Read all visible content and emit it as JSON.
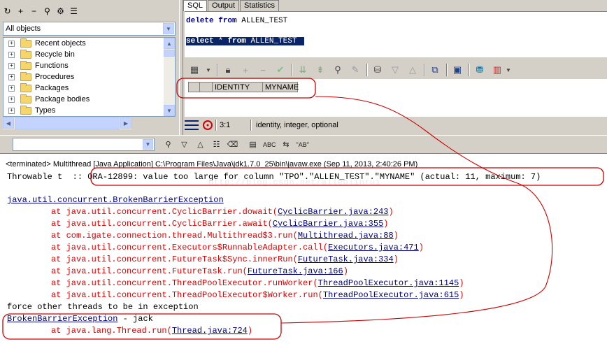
{
  "left_panel": {
    "toolbar_icons": [
      "refresh-icon",
      "add-icon",
      "remove-icon",
      "find-icon",
      "filter-icon",
      "properties-icon"
    ],
    "toolbar_glyphs": [
      "↻",
      "+",
      "−",
      "⚲",
      "⚙",
      "☰"
    ],
    "object_filter": "All objects",
    "tree_items": [
      {
        "label": "Recent objects"
      },
      {
        "label": "Recycle bin"
      },
      {
        "label": "Functions"
      },
      {
        "label": "Procedures"
      },
      {
        "label": "Packages"
      },
      {
        "label": "Package bodies"
      },
      {
        "label": "Types"
      }
    ]
  },
  "sql_pane": {
    "tabs": [
      "SQL",
      "Output",
      "Statistics"
    ],
    "active_tab": "SQL",
    "lines": [
      {
        "kw": [
          "delete",
          "from"
        ],
        "text": "delete from ALLEN_TEST"
      },
      {
        "kw": [
          "select",
          "*",
          "from"
        ],
        "text": "select * from ALLEN_TEST"
      }
    ],
    "line1": {
      "k1": "delete",
      "k2": "from",
      "rest": "ALLEN_TEST"
    },
    "line2": {
      "k1": "select",
      "star": "*",
      "k2": "from",
      "rest": "ALLEN_TEST"
    },
    "grid_columns": [
      "IDENTITY",
      "MYNAME"
    ],
    "status": {
      "position": "3:1",
      "message": "identity, integer, optional"
    }
  },
  "console": {
    "terminated_line": "<terminated> Multithread [Java Application] C:\\Program Files\\Java\\jdk1.7.0_25\\bin\\javaw.exe (Sep 11, 2013, 2:40:26 PM)",
    "throwable_prefix": "Throwable t  :: ",
    "throwable_message": "ORA-12899: value too large for column \"TPO\".\"ALLEN_TEST\".\"MYNAME\" (actual: 11, maximum: 7)",
    "exception_class": "java.util.concurrent.BrokenBarrierException",
    "stack": [
      {
        "method": "at java.util.concurrent.CyclicBarrier.dowait(",
        "src": "CyclicBarrier.java:243"
      },
      {
        "method": "at java.util.concurrent.CyclicBarrier.await(",
        "src": "CyclicBarrier.java:355"
      },
      {
        "method": "at com.igate.connection.thread.Multithread$3.run(",
        "src": "Multithread.java:88"
      },
      {
        "method": "at java.util.concurrent.Executors$RunnableAdapter.call(",
        "src": "Executors.java:471"
      },
      {
        "method": "at java.util.concurrent.FutureTask$Sync.innerRun(",
        "src": "FutureTask.java:334"
      },
      {
        "method": "at java.util.concurrent.FutureTask.run(",
        "src": "FutureTask.java:166"
      },
      {
        "method": "at java.util.concurrent.ThreadPoolExecutor.runWorker(",
        "src": "ThreadPoolExecutor.java:1145"
      },
      {
        "method": "at java.util.concurrent.ThreadPoolExecutor$Worker.run(",
        "src": "ThreadPoolExecutor.java:615"
      }
    ],
    "force_line": "force other threads to be in exception",
    "bbe_class": "BrokenBarrierException",
    "bbe_suffix": " - jack",
    "thread_method": "at java.lang.Thread.run(",
    "thread_src": "Thread.java:724",
    "watermark": "http://blog.csdn.net/allenlinrui"
  },
  "console_toolbar": {
    "buttons": [
      "binoculars-icon",
      "down-icon",
      "up-icon",
      "word-wrap-icon",
      "eraser-icon",
      "copy-icon",
      "abc-icon",
      "replace-icon",
      "quote-icon"
    ],
    "abc_label": "ABC",
    "ab_label": "\"AB\""
  },
  "colors": {
    "chrome": "#d4d0c8",
    "selection": "#0a246a",
    "error_red": "#e00000",
    "link_blue": "#000080",
    "annotation_red": "#cc0000"
  }
}
